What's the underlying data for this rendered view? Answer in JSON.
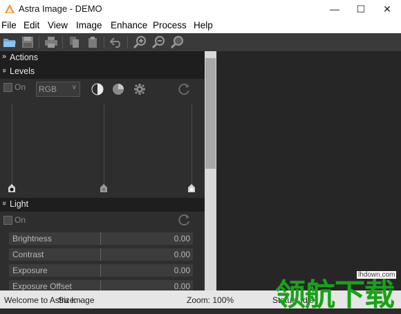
{
  "window": {
    "title": "Astra Image - DEMO",
    "minimize_glyph": "—",
    "maximize_glyph": "☐",
    "close_glyph": "✕"
  },
  "menu": [
    {
      "label": "File"
    },
    {
      "label": "Edit"
    },
    {
      "label": "View"
    },
    {
      "label": "Image"
    },
    {
      "label": "Enhance"
    },
    {
      "label": "Process"
    },
    {
      "label": "Help"
    }
  ],
  "toolbar": {
    "icons": [
      "open-folder-icon",
      "save-icon",
      "print-icon",
      "copy-icon",
      "paste-icon",
      "undo-icon",
      "zoom-in-icon",
      "zoom-out-icon",
      "zoom-actual-icon"
    ]
  },
  "panels": {
    "actions": {
      "chevron": "»",
      "title": "Actions"
    },
    "levels": {
      "chevron": "»",
      "title": "Levels",
      "on_label": "On",
      "on_checked": false,
      "channel": "RGB",
      "slider_positions": {
        "black": 0,
        "mid": 0.5,
        "white": 1
      }
    },
    "light": {
      "chevron": "»",
      "title": "Light",
      "on_label": "On",
      "on_checked": false,
      "params": [
        {
          "label": "Brightness",
          "value": "0.00"
        },
        {
          "label": "Contrast",
          "value": "0.00"
        },
        {
          "label": "Exposure",
          "value": "0.00"
        },
        {
          "label": "Exposure Offset",
          "value": "0.00"
        }
      ]
    }
  },
  "statusbar": {
    "welcome": "Welcome to Astra Image",
    "size": "Size: -",
    "zoom": "Zoom: 100%",
    "status": "Status: Idle"
  },
  "watermark": {
    "text": "领航下载",
    "url": "lhdown.com"
  }
}
